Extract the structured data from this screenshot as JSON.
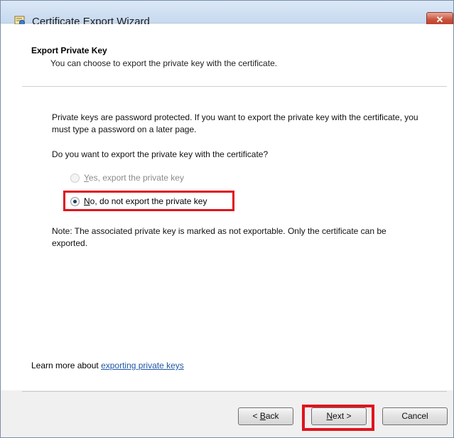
{
  "window": {
    "title": "Certificate Export Wizard",
    "close_label": "✕"
  },
  "header": {
    "title": "Export Private Key",
    "subtitle": "You can choose to export the private key with the certificate."
  },
  "body": {
    "paragraph1": "Private keys are password protected. If you want to export the private key with the certificate, you must type a password on a later page.",
    "question": "Do you want to export the private key with the certificate?",
    "options": [
      {
        "prefix": "Y",
        "rest": "es, export the private key",
        "enabled": false,
        "selected": false
      },
      {
        "prefix": "N",
        "rest": "o, do not export the private key",
        "enabled": true,
        "selected": true
      }
    ],
    "note": "Note: The associated private key is marked as not exportable. Only the certificate can be exported."
  },
  "learn_more": {
    "prefix": "Learn more about ",
    "link": "exporting private keys"
  },
  "buttons": {
    "back": {
      "prefix": "< ",
      "mnemonic": "B",
      "rest": "ack"
    },
    "next": {
      "mnemonic": "N",
      "rest": "ext >"
    },
    "cancel": "Cancel"
  },
  "colors": {
    "highlight": "#e0141c",
    "link": "#1f56a6",
    "titlebar": "#c7d9ef"
  }
}
